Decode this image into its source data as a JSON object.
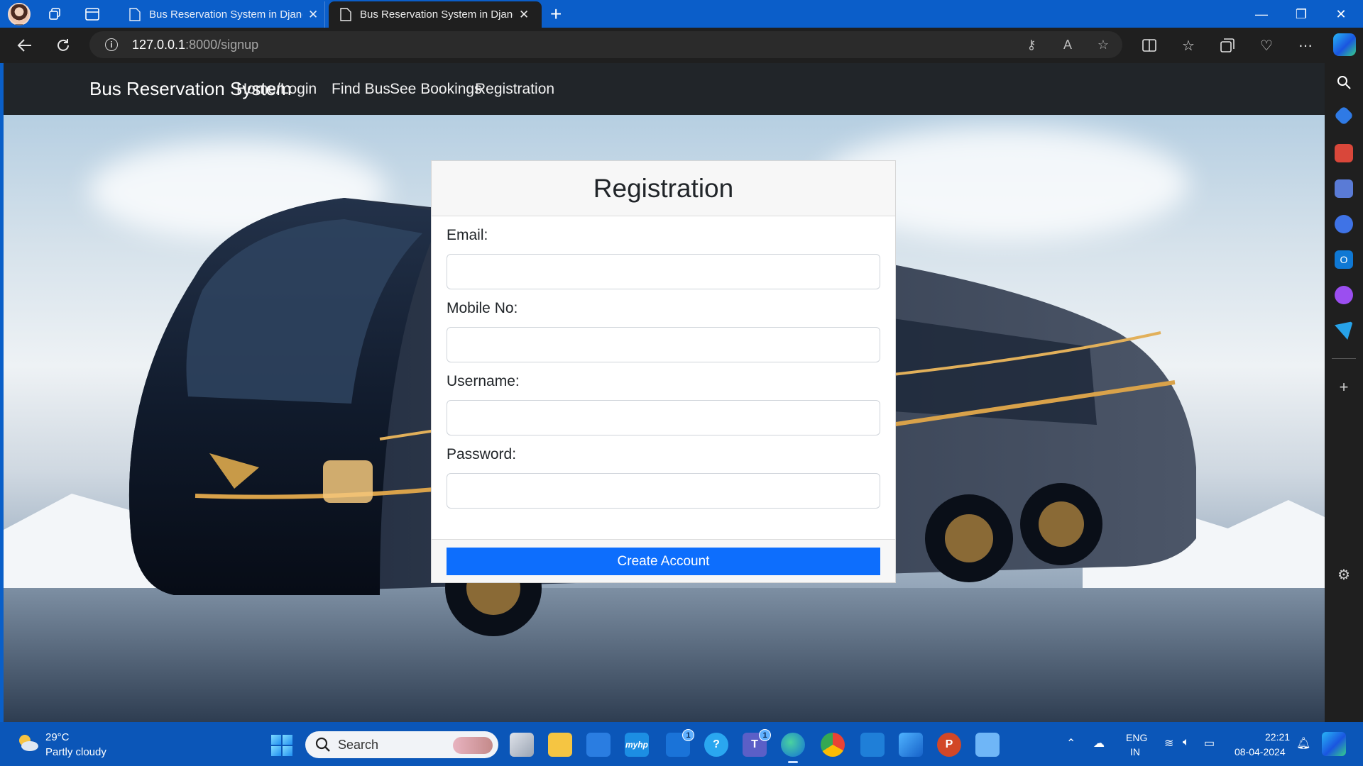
{
  "browser": {
    "tabs": [
      {
        "title": "Bus Reservation System in Django"
      },
      {
        "title": "Bus Reservation System in Django"
      }
    ],
    "close_glyph": "✕",
    "new_tab_glyph": "+",
    "url_host": "127.0.0.1",
    "url_path": ":8000/signup",
    "window_buttons": {
      "minimize": "—",
      "restore": "❐",
      "close": "✕"
    }
  },
  "site": {
    "brand": "Bus Reservation System",
    "nav": [
      {
        "label": "Home/Login"
      },
      {
        "label": "Find Bus"
      },
      {
        "label": "See Bookings"
      },
      {
        "label": "Registration"
      }
    ]
  },
  "form": {
    "title": "Registration",
    "fields": [
      {
        "label": "Email:",
        "value": ""
      },
      {
        "label": "Mobile No:",
        "value": ""
      },
      {
        "label": "Username:",
        "value": ""
      },
      {
        "label": "Password:",
        "value": ""
      }
    ],
    "submit_label": "Create Account",
    "accent_color": "#0d6efd"
  },
  "taskbar": {
    "weather_temp": "29°C",
    "weather_desc": "Partly cloudy",
    "search_placeholder": "Search",
    "badges": {
      "outlook": "1",
      "teams": "1"
    },
    "lang_1": "ENG",
    "lang_2": "IN",
    "time": "22:21",
    "date": "08-04-2024"
  }
}
